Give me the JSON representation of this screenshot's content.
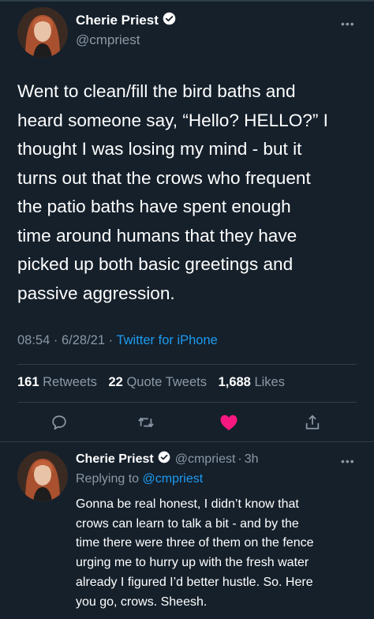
{
  "main_tweet": {
    "author": {
      "display_name": "Cherie Priest",
      "handle": "@cmpriest",
      "verified": true
    },
    "more_icon": "ellipsis-icon",
    "lines": [
      "Went to clean/fill the bird baths and",
      "heard someone say, “Hello? HELLO?” I",
      "thought I was losing my mind - but it",
      "turns out that the crows who frequent",
      "the patio baths have spent enough",
      "time around humans that they have",
      "picked up both basic greetings and",
      "passive aggression."
    ],
    "time": "08:54",
    "date": "6/28/21",
    "source": "Twitter for iPhone",
    "separator": "·",
    "stats": {
      "retweets_count": "161",
      "retweets_label": "Retweets",
      "quotes_count": "22",
      "quotes_label": "Quote Tweets",
      "likes_count": "1,688",
      "likes_label": "Likes"
    },
    "actions": [
      {
        "name": "reply",
        "icon": "comment-icon"
      },
      {
        "name": "retweet",
        "icon": "retweet-icon"
      },
      {
        "name": "like",
        "icon": "heart-icon",
        "liked": true
      },
      {
        "name": "share",
        "icon": "share-icon"
      }
    ]
  },
  "reply_tweet": {
    "author": {
      "display_name": "Cherie Priest",
      "handle": "@cmpriest",
      "verified": true
    },
    "age": "3h",
    "separator": "·",
    "replying_prefix": "Replying to",
    "replying_to": "@cmpriest",
    "more_icon": "ellipsis-icon",
    "lines": [
      "Gonna be real honest, I didn’t know that",
      "crows can learn to talk a bit - and by the",
      "time there were three of them on the fence",
      "urging me to hurry up with the fresh water",
      "already I figured I’d better hustle. So. Here",
      "you go, crows. Sheesh."
    ]
  },
  "colors": {
    "background": "#15202b",
    "text": "#ffffff",
    "secondary": "#8b98a5",
    "accent": "#1d9bf0",
    "like": "#f91880",
    "divider": "#2f3d4a"
  }
}
